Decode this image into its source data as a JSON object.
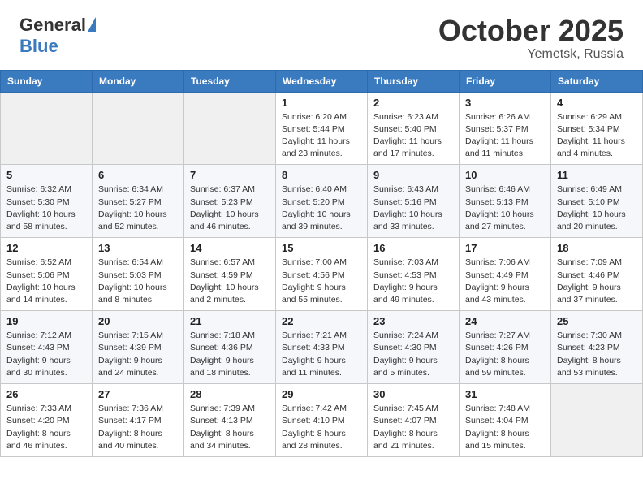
{
  "header": {
    "logo_general": "General",
    "logo_blue": "Blue",
    "title": "October 2025",
    "location": "Yemetsk, Russia"
  },
  "weekdays": [
    "Sunday",
    "Monday",
    "Tuesday",
    "Wednesday",
    "Thursday",
    "Friday",
    "Saturday"
  ],
  "weeks": [
    [
      {
        "day": "",
        "info": ""
      },
      {
        "day": "",
        "info": ""
      },
      {
        "day": "",
        "info": ""
      },
      {
        "day": "1",
        "info": "Sunrise: 6:20 AM\nSunset: 5:44 PM\nDaylight: 11 hours\nand 23 minutes."
      },
      {
        "day": "2",
        "info": "Sunrise: 6:23 AM\nSunset: 5:40 PM\nDaylight: 11 hours\nand 17 minutes."
      },
      {
        "day": "3",
        "info": "Sunrise: 6:26 AM\nSunset: 5:37 PM\nDaylight: 11 hours\nand 11 minutes."
      },
      {
        "day": "4",
        "info": "Sunrise: 6:29 AM\nSunset: 5:34 PM\nDaylight: 11 hours\nand 4 minutes."
      }
    ],
    [
      {
        "day": "5",
        "info": "Sunrise: 6:32 AM\nSunset: 5:30 PM\nDaylight: 10 hours\nand 58 minutes."
      },
      {
        "day": "6",
        "info": "Sunrise: 6:34 AM\nSunset: 5:27 PM\nDaylight: 10 hours\nand 52 minutes."
      },
      {
        "day": "7",
        "info": "Sunrise: 6:37 AM\nSunset: 5:23 PM\nDaylight: 10 hours\nand 46 minutes."
      },
      {
        "day": "8",
        "info": "Sunrise: 6:40 AM\nSunset: 5:20 PM\nDaylight: 10 hours\nand 39 minutes."
      },
      {
        "day": "9",
        "info": "Sunrise: 6:43 AM\nSunset: 5:16 PM\nDaylight: 10 hours\nand 33 minutes."
      },
      {
        "day": "10",
        "info": "Sunrise: 6:46 AM\nSunset: 5:13 PM\nDaylight: 10 hours\nand 27 minutes."
      },
      {
        "day": "11",
        "info": "Sunrise: 6:49 AM\nSunset: 5:10 PM\nDaylight: 10 hours\nand 20 minutes."
      }
    ],
    [
      {
        "day": "12",
        "info": "Sunrise: 6:52 AM\nSunset: 5:06 PM\nDaylight: 10 hours\nand 14 minutes."
      },
      {
        "day": "13",
        "info": "Sunrise: 6:54 AM\nSunset: 5:03 PM\nDaylight: 10 hours\nand 8 minutes."
      },
      {
        "day": "14",
        "info": "Sunrise: 6:57 AM\nSunset: 4:59 PM\nDaylight: 10 hours\nand 2 minutes."
      },
      {
        "day": "15",
        "info": "Sunrise: 7:00 AM\nSunset: 4:56 PM\nDaylight: 9 hours\nand 55 minutes."
      },
      {
        "day": "16",
        "info": "Sunrise: 7:03 AM\nSunset: 4:53 PM\nDaylight: 9 hours\nand 49 minutes."
      },
      {
        "day": "17",
        "info": "Sunrise: 7:06 AM\nSunset: 4:49 PM\nDaylight: 9 hours\nand 43 minutes."
      },
      {
        "day": "18",
        "info": "Sunrise: 7:09 AM\nSunset: 4:46 PM\nDaylight: 9 hours\nand 37 minutes."
      }
    ],
    [
      {
        "day": "19",
        "info": "Sunrise: 7:12 AM\nSunset: 4:43 PM\nDaylight: 9 hours\nand 30 minutes."
      },
      {
        "day": "20",
        "info": "Sunrise: 7:15 AM\nSunset: 4:39 PM\nDaylight: 9 hours\nand 24 minutes."
      },
      {
        "day": "21",
        "info": "Sunrise: 7:18 AM\nSunset: 4:36 PM\nDaylight: 9 hours\nand 18 minutes."
      },
      {
        "day": "22",
        "info": "Sunrise: 7:21 AM\nSunset: 4:33 PM\nDaylight: 9 hours\nand 11 minutes."
      },
      {
        "day": "23",
        "info": "Sunrise: 7:24 AM\nSunset: 4:30 PM\nDaylight: 9 hours\nand 5 minutes."
      },
      {
        "day": "24",
        "info": "Sunrise: 7:27 AM\nSunset: 4:26 PM\nDaylight: 8 hours\nand 59 minutes."
      },
      {
        "day": "25",
        "info": "Sunrise: 7:30 AM\nSunset: 4:23 PM\nDaylight: 8 hours\nand 53 minutes."
      }
    ],
    [
      {
        "day": "26",
        "info": "Sunrise: 7:33 AM\nSunset: 4:20 PM\nDaylight: 8 hours\nand 46 minutes."
      },
      {
        "day": "27",
        "info": "Sunrise: 7:36 AM\nSunset: 4:17 PM\nDaylight: 8 hours\nand 40 minutes."
      },
      {
        "day": "28",
        "info": "Sunrise: 7:39 AM\nSunset: 4:13 PM\nDaylight: 8 hours\nand 34 minutes."
      },
      {
        "day": "29",
        "info": "Sunrise: 7:42 AM\nSunset: 4:10 PM\nDaylight: 8 hours\nand 28 minutes."
      },
      {
        "day": "30",
        "info": "Sunrise: 7:45 AM\nSunset: 4:07 PM\nDaylight: 8 hours\nand 21 minutes."
      },
      {
        "day": "31",
        "info": "Sunrise: 7:48 AM\nSunset: 4:04 PM\nDaylight: 8 hours\nand 15 minutes."
      },
      {
        "day": "",
        "info": ""
      }
    ]
  ]
}
